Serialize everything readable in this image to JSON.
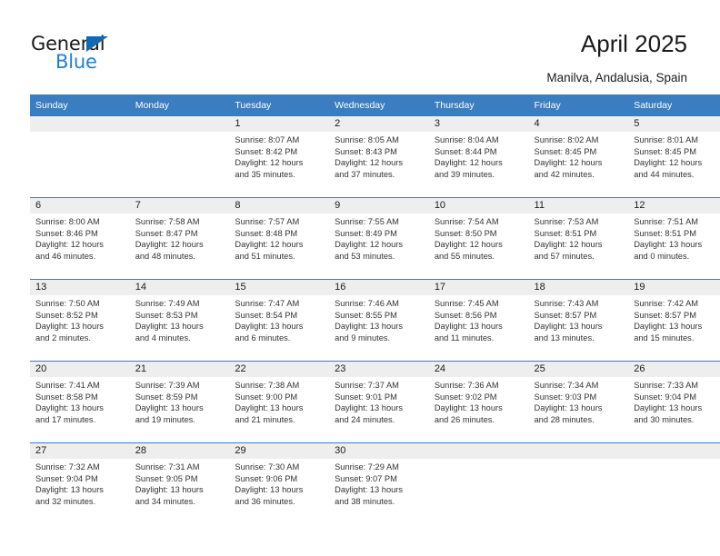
{
  "brand": {
    "name_part1": "General",
    "name_part2": "Blue",
    "triangle_color": "#1268b3",
    "blue_text_color": "#1e81d4"
  },
  "header": {
    "title": "April 2025",
    "location": "Manilva, Andalusia, Spain"
  },
  "theme": {
    "header_row_bg": "#3a7dc0",
    "daynum_strip_bg": "#eeeeee",
    "grid_line": "#3a7dc0",
    "text": "#333333"
  },
  "calendar": {
    "weekday_headers": [
      "Sunday",
      "Monday",
      "Tuesday",
      "Wednesday",
      "Thursday",
      "Friday",
      "Saturday"
    ],
    "labels": {
      "sunrise": "Sunrise:",
      "sunset": "Sunset:",
      "daylight": "Daylight:"
    },
    "weeks": [
      [
        {
          "day": "",
          "sunrise": "",
          "sunset": "",
          "daylight_line1": "",
          "daylight_line2": ""
        },
        {
          "day": "",
          "sunrise": "",
          "sunset": "",
          "daylight_line1": "",
          "daylight_line2": ""
        },
        {
          "day": "1",
          "sunrise": "Sunrise: 8:07 AM",
          "sunset": "Sunset: 8:42 PM",
          "daylight_line1": "Daylight: 12 hours",
          "daylight_line2": "and 35 minutes."
        },
        {
          "day": "2",
          "sunrise": "Sunrise: 8:05 AM",
          "sunset": "Sunset: 8:43 PM",
          "daylight_line1": "Daylight: 12 hours",
          "daylight_line2": "and 37 minutes."
        },
        {
          "day": "3",
          "sunrise": "Sunrise: 8:04 AM",
          "sunset": "Sunset: 8:44 PM",
          "daylight_line1": "Daylight: 12 hours",
          "daylight_line2": "and 39 minutes."
        },
        {
          "day": "4",
          "sunrise": "Sunrise: 8:02 AM",
          "sunset": "Sunset: 8:45 PM",
          "daylight_line1": "Daylight: 12 hours",
          "daylight_line2": "and 42 minutes."
        },
        {
          "day": "5",
          "sunrise": "Sunrise: 8:01 AM",
          "sunset": "Sunset: 8:45 PM",
          "daylight_line1": "Daylight: 12 hours",
          "daylight_line2": "and 44 minutes."
        }
      ],
      [
        {
          "day": "6",
          "sunrise": "Sunrise: 8:00 AM",
          "sunset": "Sunset: 8:46 PM",
          "daylight_line1": "Daylight: 12 hours",
          "daylight_line2": "and 46 minutes."
        },
        {
          "day": "7",
          "sunrise": "Sunrise: 7:58 AM",
          "sunset": "Sunset: 8:47 PM",
          "daylight_line1": "Daylight: 12 hours",
          "daylight_line2": "and 48 minutes."
        },
        {
          "day": "8",
          "sunrise": "Sunrise: 7:57 AM",
          "sunset": "Sunset: 8:48 PM",
          "daylight_line1": "Daylight: 12 hours",
          "daylight_line2": "and 51 minutes."
        },
        {
          "day": "9",
          "sunrise": "Sunrise: 7:55 AM",
          "sunset": "Sunset: 8:49 PM",
          "daylight_line1": "Daylight: 12 hours",
          "daylight_line2": "and 53 minutes."
        },
        {
          "day": "10",
          "sunrise": "Sunrise: 7:54 AM",
          "sunset": "Sunset: 8:50 PM",
          "daylight_line1": "Daylight: 12 hours",
          "daylight_line2": "and 55 minutes."
        },
        {
          "day": "11",
          "sunrise": "Sunrise: 7:53 AM",
          "sunset": "Sunset: 8:51 PM",
          "daylight_line1": "Daylight: 12 hours",
          "daylight_line2": "and 57 minutes."
        },
        {
          "day": "12",
          "sunrise": "Sunrise: 7:51 AM",
          "sunset": "Sunset: 8:51 PM",
          "daylight_line1": "Daylight: 13 hours",
          "daylight_line2": "and 0 minutes."
        }
      ],
      [
        {
          "day": "13",
          "sunrise": "Sunrise: 7:50 AM",
          "sunset": "Sunset: 8:52 PM",
          "daylight_line1": "Daylight: 13 hours",
          "daylight_line2": "and 2 minutes."
        },
        {
          "day": "14",
          "sunrise": "Sunrise: 7:49 AM",
          "sunset": "Sunset: 8:53 PM",
          "daylight_line1": "Daylight: 13 hours",
          "daylight_line2": "and 4 minutes."
        },
        {
          "day": "15",
          "sunrise": "Sunrise: 7:47 AM",
          "sunset": "Sunset: 8:54 PM",
          "daylight_line1": "Daylight: 13 hours",
          "daylight_line2": "and 6 minutes."
        },
        {
          "day": "16",
          "sunrise": "Sunrise: 7:46 AM",
          "sunset": "Sunset: 8:55 PM",
          "daylight_line1": "Daylight: 13 hours",
          "daylight_line2": "and 9 minutes."
        },
        {
          "day": "17",
          "sunrise": "Sunrise: 7:45 AM",
          "sunset": "Sunset: 8:56 PM",
          "daylight_line1": "Daylight: 13 hours",
          "daylight_line2": "and 11 minutes."
        },
        {
          "day": "18",
          "sunrise": "Sunrise: 7:43 AM",
          "sunset": "Sunset: 8:57 PM",
          "daylight_line1": "Daylight: 13 hours",
          "daylight_line2": "and 13 minutes."
        },
        {
          "day": "19",
          "sunrise": "Sunrise: 7:42 AM",
          "sunset": "Sunset: 8:57 PM",
          "daylight_line1": "Daylight: 13 hours",
          "daylight_line2": "and 15 minutes."
        }
      ],
      [
        {
          "day": "20",
          "sunrise": "Sunrise: 7:41 AM",
          "sunset": "Sunset: 8:58 PM",
          "daylight_line1": "Daylight: 13 hours",
          "daylight_line2": "and 17 minutes."
        },
        {
          "day": "21",
          "sunrise": "Sunrise: 7:39 AM",
          "sunset": "Sunset: 8:59 PM",
          "daylight_line1": "Daylight: 13 hours",
          "daylight_line2": "and 19 minutes."
        },
        {
          "day": "22",
          "sunrise": "Sunrise: 7:38 AM",
          "sunset": "Sunset: 9:00 PM",
          "daylight_line1": "Daylight: 13 hours",
          "daylight_line2": "and 21 minutes."
        },
        {
          "day": "23",
          "sunrise": "Sunrise: 7:37 AM",
          "sunset": "Sunset: 9:01 PM",
          "daylight_line1": "Daylight: 13 hours",
          "daylight_line2": "and 24 minutes."
        },
        {
          "day": "24",
          "sunrise": "Sunrise: 7:36 AM",
          "sunset": "Sunset: 9:02 PM",
          "daylight_line1": "Daylight: 13 hours",
          "daylight_line2": "and 26 minutes."
        },
        {
          "day": "25",
          "sunrise": "Sunrise: 7:34 AM",
          "sunset": "Sunset: 9:03 PM",
          "daylight_line1": "Daylight: 13 hours",
          "daylight_line2": "and 28 minutes."
        },
        {
          "day": "26",
          "sunrise": "Sunrise: 7:33 AM",
          "sunset": "Sunset: 9:04 PM",
          "daylight_line1": "Daylight: 13 hours",
          "daylight_line2": "and 30 minutes."
        }
      ],
      [
        {
          "day": "27",
          "sunrise": "Sunrise: 7:32 AM",
          "sunset": "Sunset: 9:04 PM",
          "daylight_line1": "Daylight: 13 hours",
          "daylight_line2": "and 32 minutes."
        },
        {
          "day": "28",
          "sunrise": "Sunrise: 7:31 AM",
          "sunset": "Sunset: 9:05 PM",
          "daylight_line1": "Daylight: 13 hours",
          "daylight_line2": "and 34 minutes."
        },
        {
          "day": "29",
          "sunrise": "Sunrise: 7:30 AM",
          "sunset": "Sunset: 9:06 PM",
          "daylight_line1": "Daylight: 13 hours",
          "daylight_line2": "and 36 minutes."
        },
        {
          "day": "30",
          "sunrise": "Sunrise: 7:29 AM",
          "sunset": "Sunset: 9:07 PM",
          "daylight_line1": "Daylight: 13 hours",
          "daylight_line2": "and 38 minutes."
        },
        {
          "day": "",
          "sunrise": "",
          "sunset": "",
          "daylight_line1": "",
          "daylight_line2": ""
        },
        {
          "day": "",
          "sunrise": "",
          "sunset": "",
          "daylight_line1": "",
          "daylight_line2": ""
        },
        {
          "day": "",
          "sunrise": "",
          "sunset": "",
          "daylight_line1": "",
          "daylight_line2": ""
        }
      ]
    ]
  }
}
